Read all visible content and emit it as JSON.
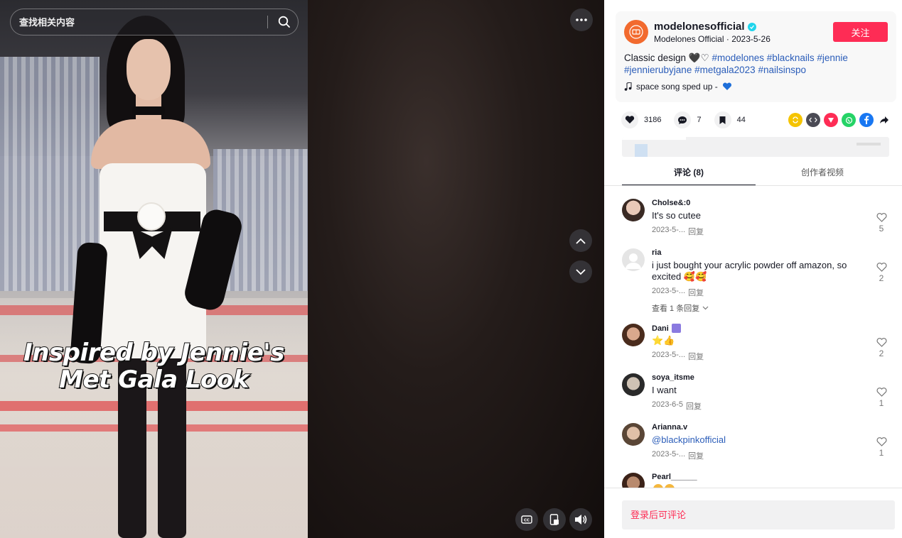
{
  "search": {
    "placeholder": "查找相关内容"
  },
  "video": {
    "overlay_text_line1": "Inspired by Jennie's",
    "overlay_text_line2": "Met Gala Look"
  },
  "author": {
    "username": "modelonesofficial",
    "display_name": "Modelones Official",
    "date": "2023-5-26",
    "follow_label": "关注",
    "desc_plain": "Classic design 🖤♡",
    "hashtags": [
      "#modelones",
      "#blacknails",
      "#jennie",
      "#jennierubyjane",
      "#metgala2023",
      "#nailsinspo"
    ],
    "music": "space song sped up - "
  },
  "stats": {
    "likes": "3186",
    "comments": "7",
    "saves": "44"
  },
  "share_icons": [
    "repost-icon",
    "embed-icon",
    "send-icon",
    "whatsapp-icon",
    "facebook-icon",
    "share-arrow-icon"
  ],
  "tabs": {
    "comments": "评论 (8)",
    "creator_videos": "创作者视频"
  },
  "comments": [
    {
      "user": "Cholse&:0",
      "text": "It's so cutee",
      "date": "2023-5-...",
      "reply": "回复",
      "likes": "5"
    },
    {
      "user": "ria",
      "text": "i just bought your acrylic powder off amazon, so excited 🥰🥰",
      "date": "2023-5-...",
      "reply": "回复",
      "likes": "2",
      "view_replies": "查看 1 条回复"
    },
    {
      "user": "Dani",
      "text": "⭐👍",
      "date": "2023-5-...",
      "reply": "回复",
      "likes": "2"
    },
    {
      "user": "soya_itsme",
      "text": "I want",
      "date": "2023-6-5",
      "reply": "回复",
      "likes": "1"
    },
    {
      "user": "Arianna.v",
      "text": "@blackpinkofficial",
      "date": "2023-5-...",
      "reply": "回复",
      "likes": "1"
    },
    {
      "user": "Pearl______",
      "text": ""
    }
  ],
  "login_prompt": "登录后可评论",
  "colors": {
    "accent": "#fe2c55",
    "hashtag": "#2b5db9",
    "verified": "#20d5ec",
    "author_avatar": "#f26a2e"
  }
}
